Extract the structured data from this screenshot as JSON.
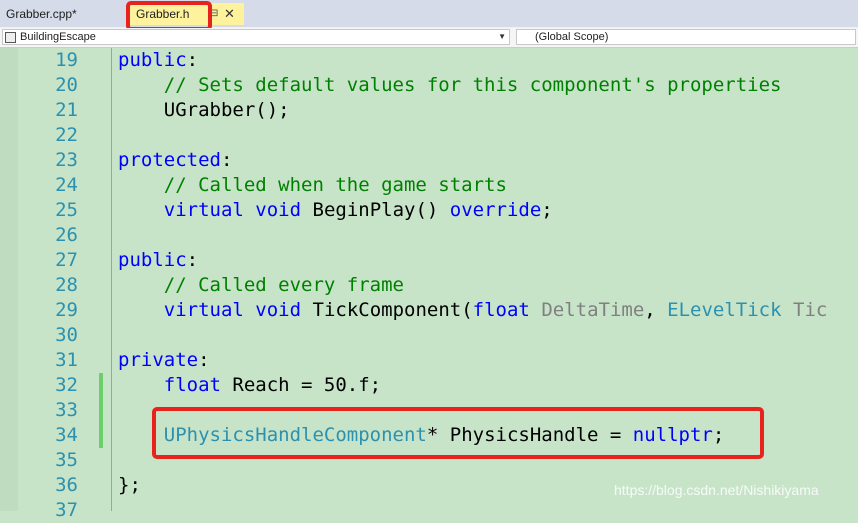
{
  "tabs": [
    {
      "label": "Grabber.cpp*",
      "active": false
    },
    {
      "label": "Grabber.h",
      "active": true
    }
  ],
  "tab_icons": {
    "pin": "pin-icon",
    "close": "close-icon"
  },
  "navbar": {
    "project": "BuildingEscape",
    "scope": "(Global Scope)"
  },
  "code_lines": [
    {
      "n": "19",
      "tokens": [
        {
          "t": "public",
          "c": "kw"
        },
        {
          "t": ":",
          "c": ""
        }
      ]
    },
    {
      "n": "20",
      "tokens": [
        {
          "t": "    // Sets default values for this component's properties",
          "c": "cm"
        }
      ]
    },
    {
      "n": "21",
      "tokens": [
        {
          "t": "    UGrabber();",
          "c": ""
        }
      ]
    },
    {
      "n": "22",
      "tokens": []
    },
    {
      "n": "23",
      "tokens": [
        {
          "t": "protected",
          "c": "kw"
        },
        {
          "t": ":",
          "c": ""
        }
      ]
    },
    {
      "n": "24",
      "tokens": [
        {
          "t": "    // Called when the game starts",
          "c": "cm"
        }
      ]
    },
    {
      "n": "25",
      "tokens": [
        {
          "t": "    ",
          "c": ""
        },
        {
          "t": "virtual",
          "c": "kw"
        },
        {
          "t": " ",
          "c": ""
        },
        {
          "t": "void",
          "c": "kw"
        },
        {
          "t": " BeginPlay() ",
          "c": ""
        },
        {
          "t": "override",
          "c": "kw"
        },
        {
          "t": ";",
          "c": ""
        }
      ]
    },
    {
      "n": "26",
      "tokens": []
    },
    {
      "n": "27",
      "tokens": [
        {
          "t": "public",
          "c": "kw"
        },
        {
          "t": ":",
          "c": ""
        }
      ]
    },
    {
      "n": "28",
      "tokens": [
        {
          "t": "    // Called every frame",
          "c": "cm"
        }
      ]
    },
    {
      "n": "29",
      "tokens": [
        {
          "t": "    ",
          "c": ""
        },
        {
          "t": "virtual",
          "c": "kw"
        },
        {
          "t": " ",
          "c": ""
        },
        {
          "t": "void",
          "c": "kw"
        },
        {
          "t": " TickComponent(",
          "c": ""
        },
        {
          "t": "float",
          "c": "kw"
        },
        {
          "t": " ",
          "c": ""
        },
        {
          "t": "DeltaTime",
          "c": "pm"
        },
        {
          "t": ", ",
          "c": ""
        },
        {
          "t": "ELevelTick",
          "c": "ty"
        },
        {
          "t": " ",
          "c": ""
        },
        {
          "t": "Tic",
          "c": "pm"
        }
      ]
    },
    {
      "n": "30",
      "tokens": []
    },
    {
      "n": "31",
      "tokens": [
        {
          "t": "private",
          "c": "kw"
        },
        {
          "t": ":",
          "c": ""
        }
      ]
    },
    {
      "n": "32",
      "tokens": [
        {
          "t": "    ",
          "c": ""
        },
        {
          "t": "float",
          "c": "kw"
        },
        {
          "t": " Reach = 50.f;",
          "c": ""
        }
      ]
    },
    {
      "n": "33",
      "tokens": []
    },
    {
      "n": "34",
      "tokens": [
        {
          "t": "    ",
          "c": ""
        },
        {
          "t": "UPhysicsHandleComponent",
          "c": "ty"
        },
        {
          "t": "* PhysicsHandle = ",
          "c": ""
        },
        {
          "t": "nullptr",
          "c": "kw"
        },
        {
          "t": ";",
          "c": ""
        }
      ]
    },
    {
      "n": "35",
      "tokens": []
    },
    {
      "n": "36",
      "tokens": [
        {
          "t": "};",
          "c": ""
        }
      ]
    },
    {
      "n": "37",
      "tokens": []
    }
  ],
  "watermark": "https://blog.csdn.net/Nishikiyama",
  "colors": {
    "editor_bg": "#c7e4c9",
    "keyword": "#0000ff",
    "comment": "#008000",
    "type": "#2b91af",
    "highlight_box": "#e8231d"
  }
}
